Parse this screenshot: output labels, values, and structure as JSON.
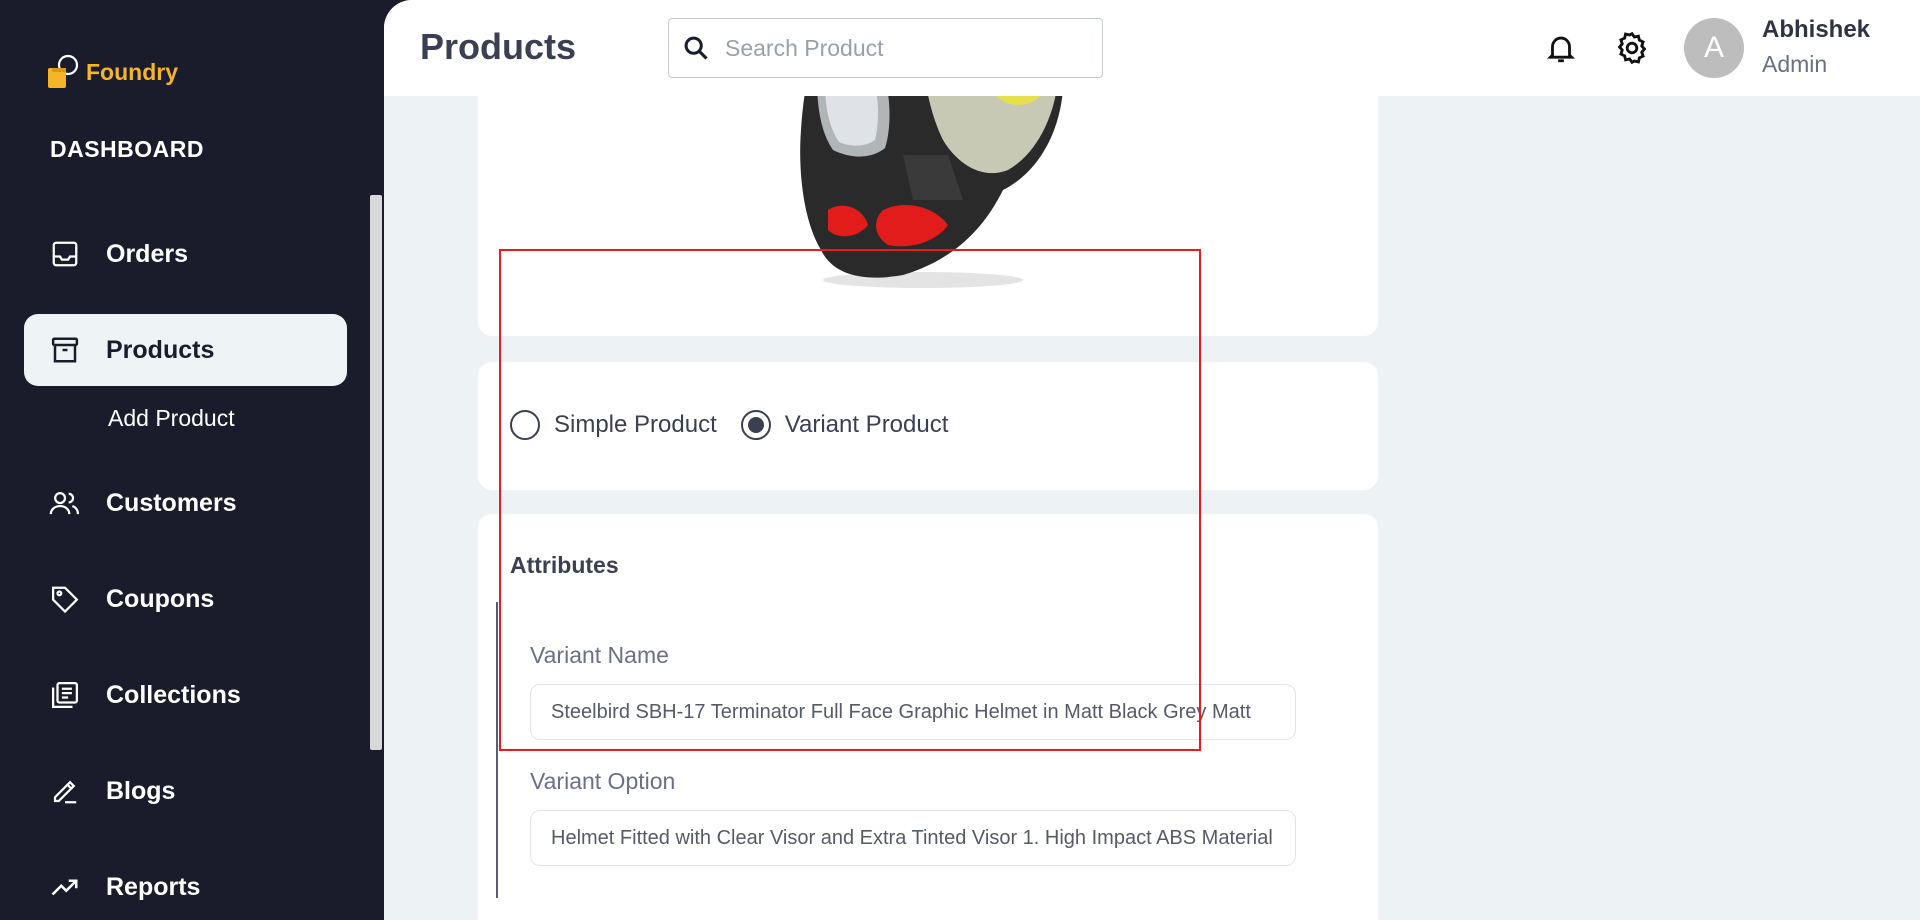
{
  "brand": {
    "name": "Foundry"
  },
  "sidebar": {
    "section_label": "DASHBOARD",
    "items": [
      {
        "label": "Orders",
        "icon": "inbox-icon"
      },
      {
        "label": "Products",
        "icon": "archive-icon",
        "active": true
      },
      {
        "label": "Customers",
        "icon": "users-icon"
      },
      {
        "label": "Coupons",
        "icon": "tag-icon"
      },
      {
        "label": "Collections",
        "icon": "collections-icon"
      },
      {
        "label": "Blogs",
        "icon": "edit-icon"
      },
      {
        "label": "Reports",
        "icon": "trending-up-icon"
      }
    ],
    "sub_items": [
      {
        "label": "Add Product"
      }
    ]
  },
  "header": {
    "title": "Products",
    "search_placeholder": "Search Product",
    "user": {
      "initial": "A",
      "name": "Abhishek",
      "role": "Admin"
    }
  },
  "product_type": {
    "options": [
      {
        "label": "Simple Product",
        "selected": false
      },
      {
        "label": "Variant Product",
        "selected": true
      }
    ]
  },
  "attributes": {
    "title": "Attributes",
    "variant_name_label": "Variant Name",
    "variant_name_value": "Steelbird SBH-17 Terminator Full Face Graphic Helmet in Matt Black Grey Matt",
    "variant_option_label": "Variant Option",
    "variant_option_value": "Helmet Fitted with Clear Visor and Extra Tinted Visor 1. High Impact ABS Material"
  },
  "colors": {
    "sidebar_bg": "#1a1c2b",
    "brand": "#f5b52a",
    "content_bg": "#edf2f5",
    "highlight": "#e81c1c"
  }
}
